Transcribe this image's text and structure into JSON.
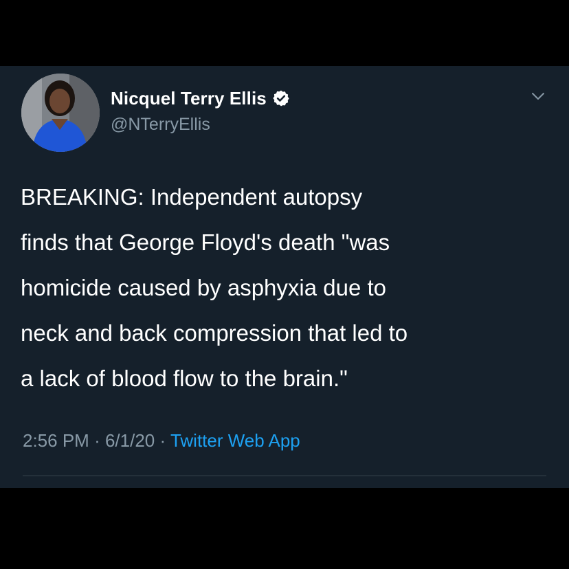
{
  "tweet": {
    "author_name": "Nicquel Terry Ellis",
    "author_handle": "@NTerryEllis",
    "verified": true,
    "text": "BREAKING: Independent autopsy\nfinds that George Floyd's death \"was\nhomicide caused by asphyxia due to\nneck and back compression that led to\na lack of blood flow to the brain.\"",
    "time": "2:56 PM",
    "date": "6/1/20",
    "separator": "·",
    "source": "Twitter Web App"
  },
  "icons": {
    "verified": "verified-badge-icon",
    "menu": "chevron-down-icon"
  },
  "colors": {
    "background": "#15202b",
    "letterbox": "#000000",
    "primary_text": "#ffffff",
    "secondary_text": "#8899a6",
    "link": "#1da1f2",
    "divider": "#38444d"
  }
}
